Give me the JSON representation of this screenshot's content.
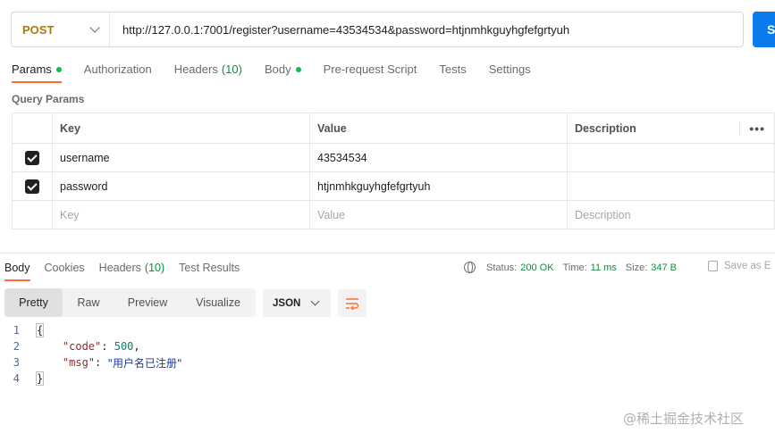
{
  "request": {
    "method": "POST",
    "url": "http://127.0.0.1:7001/register?username=43534534&password=htjnmhkguyhgfefgrtyuh",
    "send_label": "S"
  },
  "request_tabs": [
    {
      "label": "Params",
      "active": true,
      "dot": true
    },
    {
      "label": "Authorization"
    },
    {
      "label": "Headers",
      "count": "(10)"
    },
    {
      "label": "Body",
      "dot": true
    },
    {
      "label": "Pre-request Script"
    },
    {
      "label": "Tests"
    },
    {
      "label": "Settings"
    }
  ],
  "query_params": {
    "title": "Query Params",
    "columns": [
      "Key",
      "Value",
      "Description"
    ],
    "more": "•••",
    "rows": [
      {
        "checked": true,
        "key": "username",
        "value": "43534534",
        "description": ""
      },
      {
        "checked": true,
        "key": "password",
        "value": "htjnmhkguyhgfefgrtyuh",
        "description": ""
      }
    ],
    "placeholder": {
      "key": "Key",
      "value": "Value",
      "description": "Description"
    }
  },
  "response_tabs": [
    {
      "label": "Body",
      "active": true
    },
    {
      "label": "Cookies"
    },
    {
      "label": "Headers",
      "count": "(10)"
    },
    {
      "label": "Test Results"
    }
  ],
  "status": {
    "status_label": "Status:",
    "status_value": "200 OK",
    "time_label": "Time:",
    "time_value": "11 ms",
    "size_label": "Size:",
    "size_value": "347 B",
    "save_label": "Save as E"
  },
  "view_modes": [
    "Pretty",
    "Raw",
    "Preview",
    "Visualize"
  ],
  "format": "JSON",
  "code": {
    "line_numbers": [
      "1",
      "2",
      "3",
      "4"
    ],
    "open_brace": "{",
    "close_brace": "}",
    "code_key": "\"code\"",
    "code_value": "500",
    "msg_key": "\"msg\"",
    "msg_value": "\"用户名已注册\""
  },
  "watermark": "@稀土掘金技术社区",
  "colors": {
    "accent": "#ff6c37",
    "send": "#097bed",
    "method": "#ad7a03",
    "status_ok": "#0a8f3d"
  }
}
